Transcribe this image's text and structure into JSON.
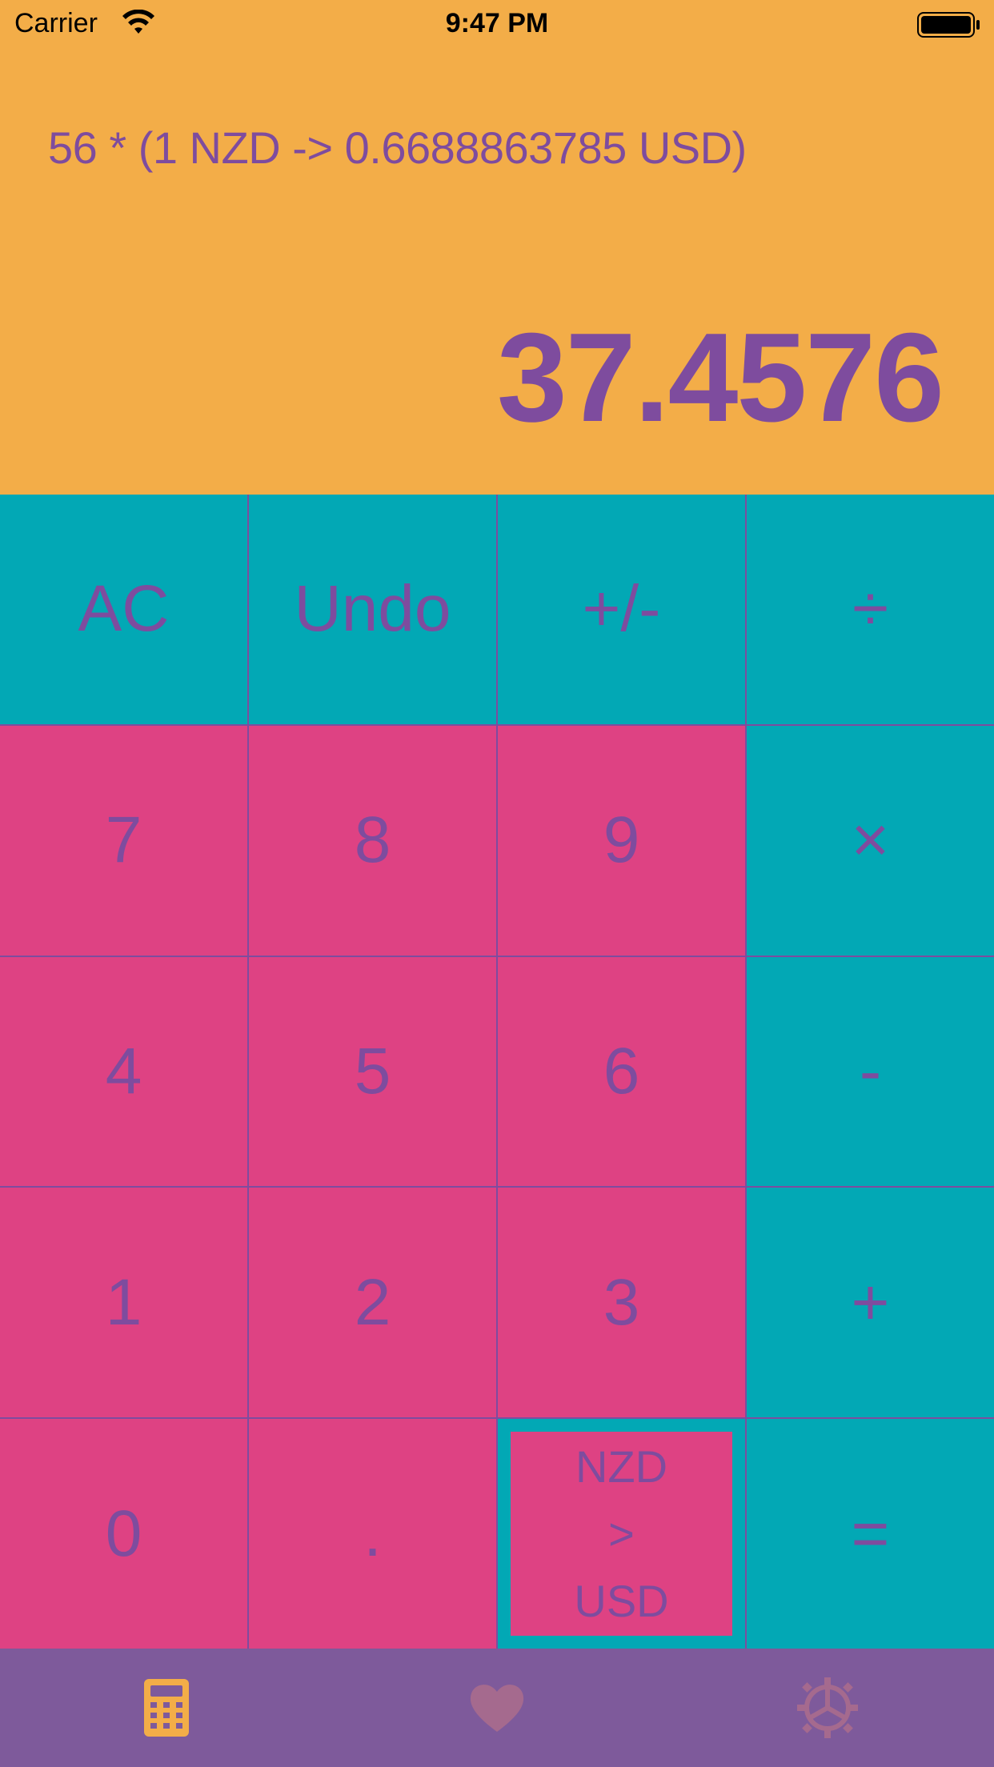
{
  "status": {
    "carrier": "Carrier",
    "time": "9:47 PM"
  },
  "display": {
    "expression": "56 * (1 NZD -> 0.6688863785 USD)",
    "result": "37.4576"
  },
  "keys": {
    "ac": "AC",
    "undo": "Undo",
    "sign": "+/-",
    "divide": "÷",
    "seven": "7",
    "eight": "8",
    "nine": "9",
    "multiply": "×",
    "four": "4",
    "five": "5",
    "six": "6",
    "minus": "-",
    "one": "1",
    "two": "2",
    "three": "3",
    "plus": "+",
    "zero": "0",
    "decimal": ".",
    "convert": {
      "from": "NZD",
      "arrow": ">",
      "to": "USD"
    },
    "equals": "="
  },
  "tabs": [
    {
      "icon": "calculator-icon",
      "active": true
    },
    {
      "icon": "heart-icon",
      "active": false
    },
    {
      "icon": "gear-icon",
      "active": false
    }
  ],
  "colors": {
    "display_bg": "#F3AD48",
    "operator_bg": "#02A8B5",
    "number_bg": "#DE4283",
    "text": "#7E4C9E",
    "tabbar_bg": "#7E5A9B",
    "tab_active": "#F3AD48",
    "tab_inactive": "#A56A8E"
  }
}
